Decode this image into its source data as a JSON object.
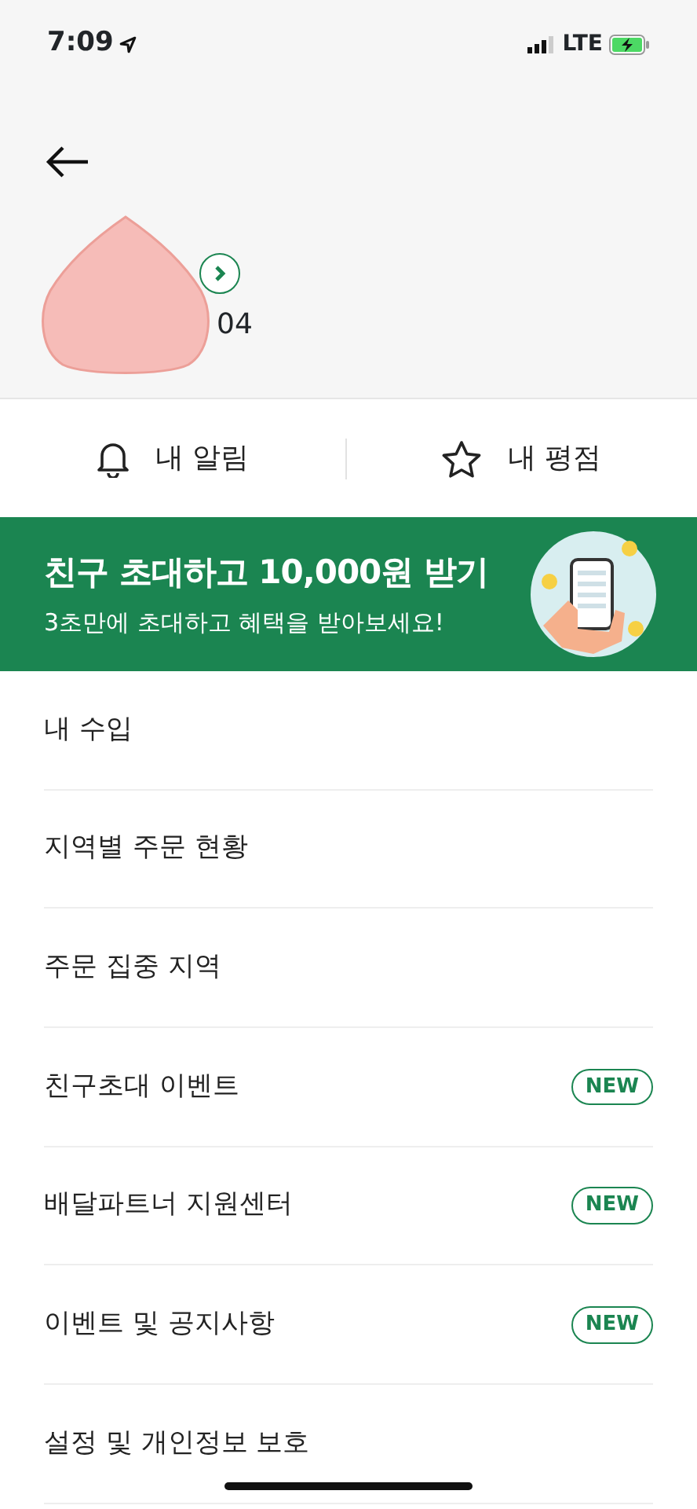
{
  "status_bar": {
    "time": "7:09",
    "network": "LTE"
  },
  "profile": {
    "visible_text": "04"
  },
  "quick_actions": [
    {
      "kind": "bell",
      "label": "내 알림"
    },
    {
      "kind": "star",
      "label": "내 평점"
    }
  ],
  "banner": {
    "title": "친구 초대하고 **10,000원** 받기",
    "subtitle": "3초만에 초대하고 혜택을 받아보세요!"
  },
  "menu": [
    {
      "label": "내 수입"
    },
    {
      "label": "지역별 주문 현황"
    },
    {
      "label": "주문 집중 지역"
    },
    {
      "label": "친구초대 이벤트",
      "badge": "NEW"
    },
    {
      "label": "배달파트너 지원센터",
      "badge": "NEW"
    },
    {
      "label": "이벤트 및 공지사항",
      "badge": "NEW"
    },
    {
      "label": "설정 및 개인정보 보호"
    }
  ]
}
